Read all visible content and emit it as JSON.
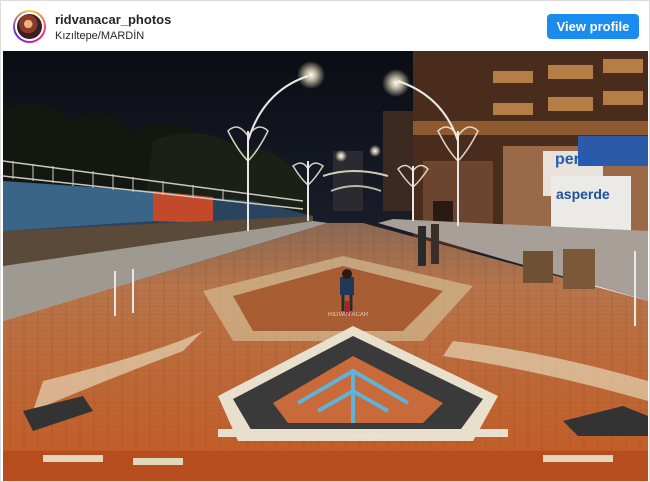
{
  "post": {
    "username": "ridvanacar_photos",
    "location": "Kızıltepe/MARDİN",
    "view_profile_label": "View profile"
  },
  "photo": {
    "sign_text_1": "perde",
    "sign_text_2": "asperde",
    "watermark_1": "RIDVAN ACAR",
    "watermark_2": "RIDVAN ACAR"
  },
  "icons": {
    "avatar": "profile-avatar"
  },
  "colors": {
    "button": "#1a8cf0",
    "brick_orange": "#c8602a",
    "night_sky": "#0e1016"
  }
}
